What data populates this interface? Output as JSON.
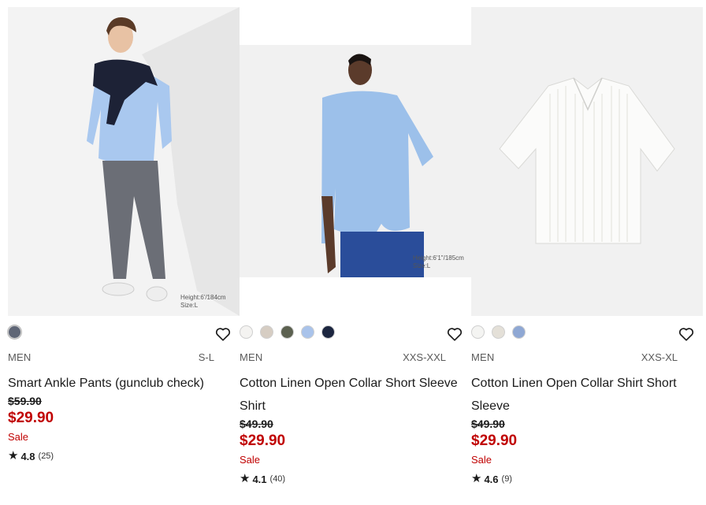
{
  "products": [
    {
      "model_caption": [
        "Height:6'/184cm",
        "Size:L"
      ],
      "swatches": [
        {
          "name": "gray",
          "color": "#5f6676"
        }
      ],
      "wishlist_icon": "heart-outline-icon",
      "gender": "MEN",
      "sizes": "S-L",
      "name": "Smart Ankle Pants (gunclub check)",
      "original_price": "$59.90",
      "sale_price": "$29.90",
      "sale_label": "Sale",
      "rating": "4.8",
      "review_count": "(25)"
    },
    {
      "model_caption": [
        "Height:6'1\"/185cm",
        "Size:L"
      ],
      "swatches": [
        {
          "name": "white",
          "color": "#f4f3f1"
        },
        {
          "name": "beige",
          "color": "#d6cdc3"
        },
        {
          "name": "olive",
          "color": "#5c6150"
        },
        {
          "name": "light-blue",
          "color": "#a9c3ea"
        },
        {
          "name": "navy",
          "color": "#1c2640"
        }
      ],
      "wishlist_icon": "heart-outline-icon",
      "gender": "MEN",
      "sizes": "XXS-XXL",
      "name": "Cotton Linen Open Collar Short Sleeve Shirt",
      "original_price": "$49.90",
      "sale_price": "$29.90",
      "sale_label": "Sale",
      "rating": "4.1",
      "review_count": "(40)"
    },
    {
      "swatches": [
        {
          "name": "white",
          "color": "#f4f4f2"
        },
        {
          "name": "off-white-stripe",
          "color": "#e4e0d8"
        },
        {
          "name": "blue-stripe",
          "color": "#8fa8d4"
        }
      ],
      "wishlist_icon": "heart-outline-icon",
      "gender": "MEN",
      "sizes": "XXS-XL",
      "name": "Cotton Linen Open Collar Shirt Short Sleeve",
      "original_price": "$49.90",
      "sale_price": "$29.90",
      "sale_label": "Sale",
      "rating": "4.6",
      "review_count": "(9)"
    }
  ],
  "colors": {
    "sale_red": "#c00000",
    "text": "#1b1b1b",
    "muted": "#5a5a5a"
  }
}
